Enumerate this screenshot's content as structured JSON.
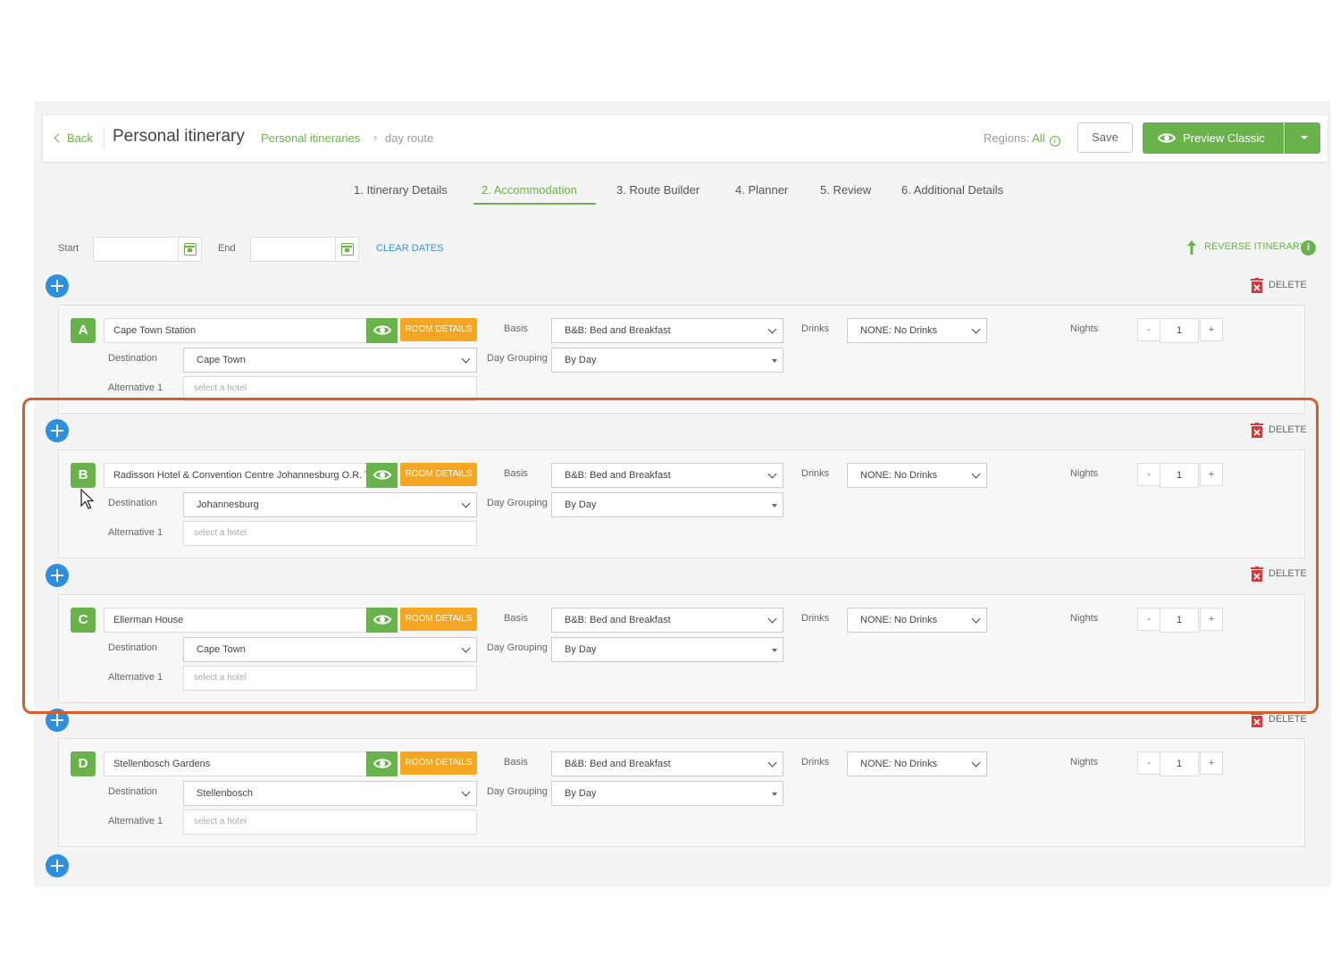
{
  "header": {
    "back_label": "Back",
    "title": "Personal itinerary",
    "breadcrumb_link": "Personal itineraries",
    "breadcrumb_sep": "›",
    "breadcrumb_current": "day route",
    "regions_label": "Regions:",
    "regions_value": "All",
    "save_label": "Save",
    "preview_label": "Preview Classic"
  },
  "tabs": [
    {
      "label": "1. Itinerary Details"
    },
    {
      "label": "2. Accommodation",
      "active": true
    },
    {
      "label": "3. Route Builder"
    },
    {
      "label": "4. Planner"
    },
    {
      "label": "5. Review"
    },
    {
      "label": "6. Additional Details"
    }
  ],
  "dates": {
    "start_label": "Start",
    "start_value": "",
    "end_label": "End",
    "end_value": "",
    "clear_label": "CLEAR DATES",
    "reverse_label": "REVERSE ITINERARY"
  },
  "labels": {
    "delete": "DELETE",
    "room_details": "ROOM DETAILS",
    "basis": "Basis",
    "drinks": "Drinks",
    "nights": "Nights",
    "destination": "Destination",
    "day_grouping": "Day Grouping",
    "alternative": "Alternative 1",
    "minus": "-",
    "plus": "+"
  },
  "stops": [
    {
      "letter": "A",
      "hotel": "Cape Town Station",
      "destination": "Cape Town",
      "basis": "B&B: Bed and Breakfast",
      "drinks": "NONE: No Drinks",
      "day_grouping": "By Day",
      "alternative_placeholder": "select a hotel",
      "nights": "1"
    },
    {
      "letter": "B",
      "hotel": "Radisson Hotel & Convention Centre Johannesburg O.R. Ta",
      "destination": "Johannesburg",
      "basis": "B&B: Bed and Breakfast",
      "drinks": "NONE: No Drinks",
      "day_grouping": "By Day",
      "alternative_placeholder": "select a hotel",
      "nights": "1"
    },
    {
      "letter": "C",
      "hotel": "Ellerman House",
      "destination": "Cape Town",
      "basis": "B&B: Bed and Breakfast",
      "drinks": "NONE: No Drinks",
      "day_grouping": "By Day",
      "alternative_placeholder": "select a hotel",
      "nights": "1"
    },
    {
      "letter": "D",
      "hotel": "Stellenbosch Gardens",
      "destination": "Stellenbosch",
      "basis": "B&B: Bed and Breakfast",
      "drinks": "NONE: No Drinks",
      "day_grouping": "By Day",
      "alternative_placeholder": "select a hotel",
      "nights": "1"
    }
  ],
  "colors": {
    "accent_green": "#6ab24c",
    "room_details_orange": "#f5a623",
    "add_blue": "#2d8fe0",
    "delete_red": "#d9383a",
    "highlight_orange": "#d35f2a"
  }
}
